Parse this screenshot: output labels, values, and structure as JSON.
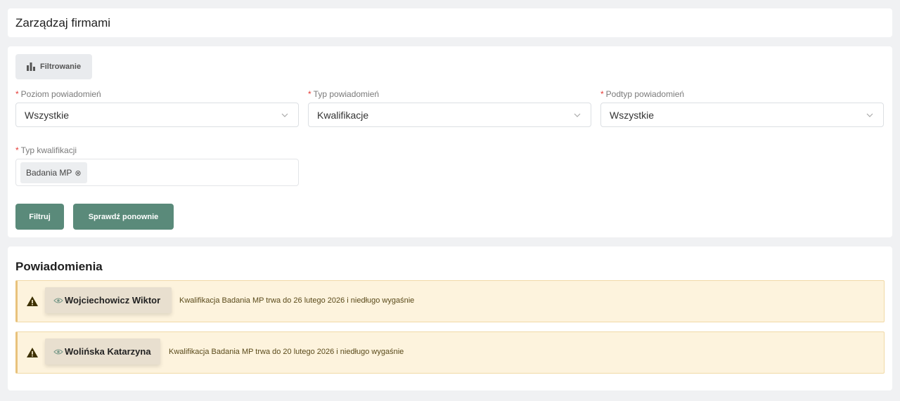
{
  "header": {
    "title": "Zarządzaj firmami"
  },
  "filters": {
    "toggle_label": "Filtrowanie",
    "required_mark": "*",
    "level": {
      "label": "Poziom powiadomień",
      "value": "Wszystkie"
    },
    "type": {
      "label": "Typ powiadomień",
      "value": "Kwalifikacje"
    },
    "subtype": {
      "label": "Podtyp powiadomień",
      "value": "Wszystkie"
    },
    "qualification": {
      "label": "Typ kwalifikacji",
      "tags": [
        "Badania MP"
      ]
    },
    "filter_button": "Filtruj",
    "recheck_button": "Sprawdź ponownie"
  },
  "notifications": {
    "title": "Powiadomienia",
    "items": [
      {
        "person": "Wojciechowicz Wiktor",
        "text": "Kwalifikacja Badania MP trwa do 26 lutego 2026 i niedługo wygaśnie"
      },
      {
        "person": "Wolińska Katarzyna",
        "text": "Kwalifikacja Badania MP trwa do 20 lutego 2026 i niedługo wygaśnie"
      }
    ]
  },
  "colors": {
    "primary_button": "#5a8a7a",
    "warning_bg": "#fdf3dd",
    "warning_border": "#e8c27c",
    "required": "#e53935"
  },
  "icons": [
    "bar-chart-icon",
    "chevron-down-icon",
    "tag-remove-icon",
    "warning-icon",
    "eye-icon"
  ]
}
